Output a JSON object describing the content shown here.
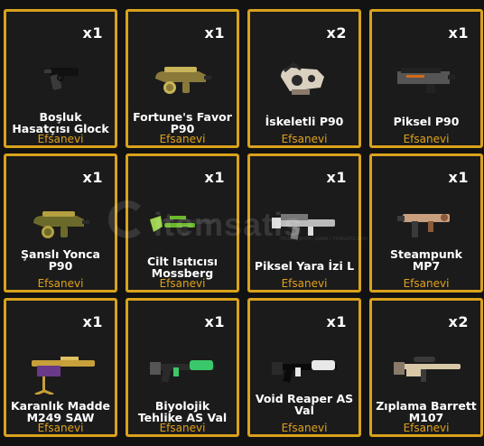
{
  "items": [
    {
      "qty": "x1",
      "name": "Boşluk Hasatçısı Glock",
      "rarity": "Efsanevi",
      "gun": "pistol",
      "colors": [
        "#111111",
        "#3a3a3a"
      ]
    },
    {
      "qty": "x1",
      "name": "Fortune's Favor P90",
      "rarity": "Efsanevi",
      "gun": "p90",
      "colors": [
        "#8a7a3a",
        "#c9b45a",
        "#2a2a2a"
      ]
    },
    {
      "qty": "x2",
      "name": "İskeletli P90",
      "rarity": "Efsanevi",
      "gun": "p90skull",
      "colors": [
        "#d9d0c0",
        "#2a2a2a",
        "#8a7a6a"
      ]
    },
    {
      "qty": "x1",
      "name": "Piksel P90",
      "rarity": "Efsanevi",
      "gun": "p90pixel",
      "colors": [
        "#555555",
        "#222222",
        "#d26a1a"
      ]
    },
    {
      "qty": "x1",
      "name": "Şanslı Yonca P90",
      "rarity": "Efsanevi",
      "gun": "p90",
      "colors": [
        "#6b6a2a",
        "#b4a040",
        "#2a2a2a"
      ]
    },
    {
      "qty": "x1",
      "name": "Cilt Isıtıcısı Mossberg",
      "rarity": "Efsanevi",
      "gun": "shotgun",
      "colors": [
        "#6ab82a",
        "#2a2a2a",
        "#9ad24a"
      ]
    },
    {
      "qty": "x1",
      "name": "Piksel Yara İzi L",
      "rarity": "Efsanevi",
      "gun": "rifle",
      "colors": [
        "#bbbbbb",
        "#777777",
        "#dddddd"
      ]
    },
    {
      "qty": "x1",
      "name": "Steampunk MP7",
      "rarity": "Efsanevi",
      "gun": "mp7",
      "colors": [
        "#c8a080",
        "#3a3a3a",
        "#8a5a3a"
      ]
    },
    {
      "qty": "x1",
      "name": "Karanlık Madde M249 SAW",
      "rarity": "Efsanevi",
      "gun": "lmg",
      "colors": [
        "#c8a03a",
        "#6a3a8a",
        "#e0c060"
      ]
    },
    {
      "qty": "x1",
      "name": "Biyolojik Tehlike AS Val",
      "rarity": "Efsanevi",
      "gun": "val",
      "colors": [
        "#2a2a2a",
        "#3ac86a",
        "#555555"
      ]
    },
    {
      "qty": "x1",
      "name": "Void Reaper AS Val",
      "rarity": "Efsanevi",
      "gun": "val",
      "colors": [
        "#0a0a0a",
        "#e8e8e8",
        "#2a2a2a"
      ]
    },
    {
      "qty": "x2",
      "name": "Zıplama Barrett M107",
      "rarity": "Efsanevi",
      "gun": "sniper",
      "colors": [
        "#d8c8a8",
        "#3a3a3a",
        "#8a7a6a"
      ]
    }
  ],
  "watermark": {
    "brand": "itemsatis",
    "sub": "TRUST | SHOP | GAME | ITEMSATIS.COM"
  }
}
